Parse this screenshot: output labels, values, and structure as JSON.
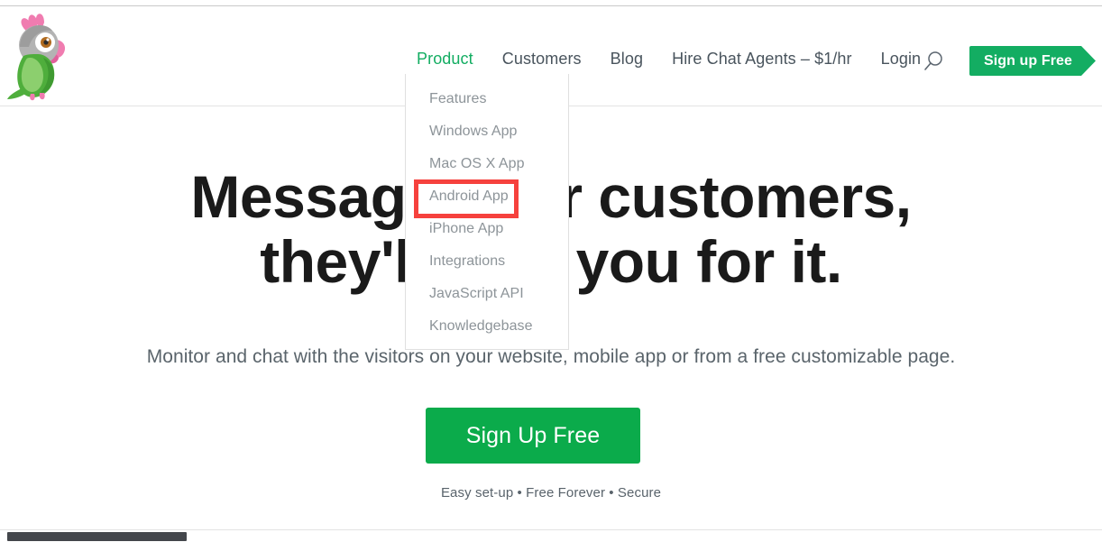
{
  "brand": {
    "logo_icon": "parrot-logo-icon",
    "accent_green": "#13ad62",
    "cta_green": "#0bab4b",
    "annotation_red": "#f6413d"
  },
  "header": {
    "nav": [
      {
        "label": "Product",
        "active": true
      },
      {
        "label": "Customers",
        "active": false
      },
      {
        "label": "Blog",
        "active": false
      },
      {
        "label": "Hire Chat Agents – $1/hr",
        "active": false
      },
      {
        "label": "Login",
        "active": false
      }
    ],
    "search_icon": "search-icon",
    "cta_label": "Sign up Free"
  },
  "dropdown": {
    "open_for": "Product",
    "items": [
      {
        "label": "Features",
        "highlighted": false
      },
      {
        "label": "Windows App",
        "highlighted": false
      },
      {
        "label": "Mac OS X App",
        "highlighted": false
      },
      {
        "label": "Android App",
        "highlighted": true
      },
      {
        "label": "iPhone App",
        "highlighted": false
      },
      {
        "label": "Integrations",
        "highlighted": false
      },
      {
        "label": "JavaScript API",
        "highlighted": false
      },
      {
        "label": "Knowledgebase",
        "highlighted": false
      }
    ]
  },
  "hero": {
    "headline_line1": "Message your customers,",
    "headline_line2": "they'll love you for it.",
    "subheadline": "Monitor and chat with the visitors on your website, mobile app or from a free customizable page.",
    "cta_label": "Sign Up Free",
    "note": "Easy set-up • Free Forever • Secure"
  },
  "scrollbar": {
    "orientation": "horizontal",
    "thumb_position": "left"
  }
}
